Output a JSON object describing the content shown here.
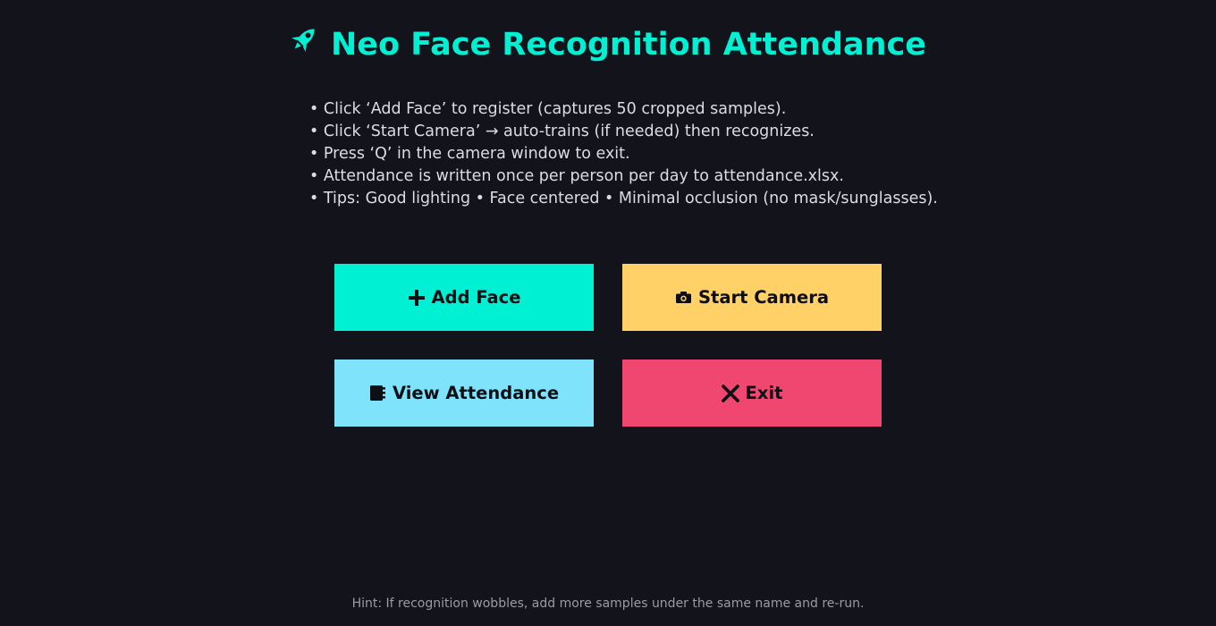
{
  "window": {
    "title": "Neo Face Recognition Attendance",
    "title_icon": "rocket-icon"
  },
  "instructions": [
    "• Click ‘Add Face’ to register (captures 50 cropped samples).",
    "• Click ‘Start Camera’ → auto-trains (if needed) then recognizes.",
    "• Press ‘Q’ in the camera window to exit.",
    "• Attendance is written once per person per day to attendance.xlsx.",
    "• Tips: Good lighting • Face centered • Minimal occlusion (no mask/sunglasses)."
  ],
  "buttons": {
    "add_face": {
      "label": "Add Face",
      "icon": "plus-icon",
      "color": "#00f0d4"
    },
    "start_camera": {
      "label": "Start Camera",
      "icon": "camera-icon",
      "color": "#ffd166"
    },
    "view_attendance": {
      "label": "View Attendance",
      "icon": "notebook-icon",
      "color": "#7fe3fb"
    },
    "exit": {
      "label": "Exit",
      "icon": "close-icon",
      "color": "#ef476f"
    }
  },
  "hint": "Hint: If recognition wobbles, add more samples under the same name and re-run.",
  "colors": {
    "background": "#12131b",
    "accent": "#00f0d4",
    "text": "#dcdde3",
    "hint_text": "#9a9ba3"
  }
}
